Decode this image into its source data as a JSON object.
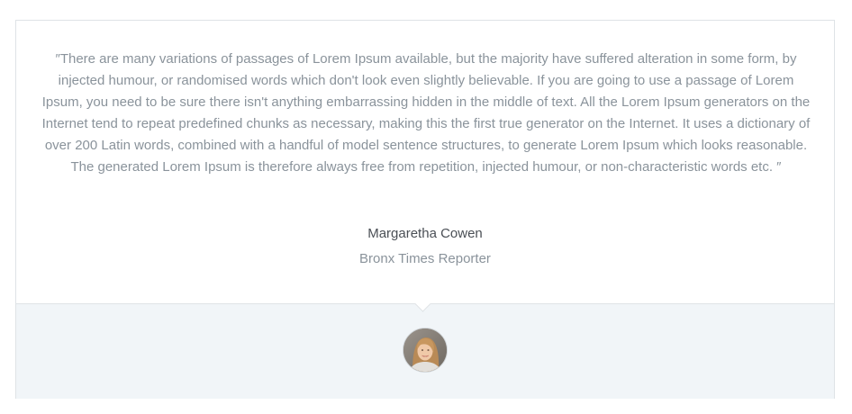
{
  "testimonial": {
    "quote": "″There are many variations of passages of Lorem Ipsum available, but the majority have suffered alteration in some form, by injected humour, or randomised words which don't look even slightly believable. If you are going to use a passage of Lorem Ipsum, you need to be sure there isn't anything embarrassing hidden in the middle of text. All the Lorem Ipsum generators on the Internet tend to repeat predefined chunks as necessary, making this the first true generator on the Internet. It uses a dictionary of over 200 Latin words, combined with a handful of model sentence structures, to generate Lorem Ipsum which looks reasonable. The generated Lorem Ipsum is therefore always free from repetition, injected humour, or non-characteristic words etc. ″",
    "author_name": "Margaretha Cowen",
    "author_role": "Bronx Times Reporter",
    "avatar_icon": "woman-portrait-avatar"
  },
  "colors": {
    "quote_text": "#8a939b",
    "author_name": "#4a4f55",
    "footer_background": "#f1f5f8",
    "border": "#dfe3e6"
  }
}
